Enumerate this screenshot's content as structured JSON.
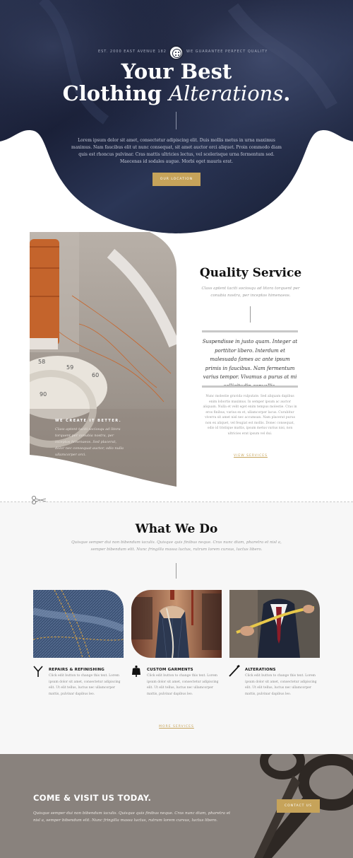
{
  "hero": {
    "est_text": "EST. 2000 EAST AVENUE 182",
    "guarantee_text": "WE GUARANTEE PERFECT QUALITY",
    "title_line1": "Your Best",
    "title_line2_plain": "Clothing ",
    "title_line2_italic": "Alterations",
    "title_line2_end": ".",
    "body": "Lorem ipsum dolor sit amet, consectetur adipiscing elit. Duis mollis metus in urna maximus maximus. Nam faucibus elit ut nunc consequat, sit amet auctor orci aliquet. Proin commodo diam quis est rhoncus pulvinar. Cras mattis ultricies lectus, vel scelerisque urna fermentum sed. Maecenas id sodales augue. Morbi eget mauris erat.",
    "button_label": "OUR LOCATION"
  },
  "quality": {
    "overlay_title": "WE CREATE IT BETTER.",
    "overlay_text": "Class aptent taciti sociosqu ad litora torquent per conubia nostra, per inceptos himenaeos. Sed placerat, dolor nec consequat auctor, odio nulla ullamcorper orci.",
    "title": "Quality Service",
    "subtitle": "Class aptent taciti sociosqu ad litora torquent per conubia nostra, per inceptos himenaeos.",
    "quote": "Suspendisse in justo quam. Integer at porttitor libero. Interdum et malesuada fames ac ante ipsum primis in faucibus. Nam fermentum varius tempor. Vivamus a purus at mi sollicitudin convallis.",
    "body": "Nunc molestie gravida vulputate. Sed aliquam dapibus enim lobortis maximus. In semper ipsum ac auctor aliquam. Nulla et velit eget enim tempus molestie. Cras in eros finibus, varius ex et, ullamcorper lacus. Curabitur viverra sit amet nisl nec accumsan. Nam placerat purus non ex aliquet, vel feugiat est mollis. Donec consequat, odio id tristique mattis, ipsum metus varius nisi, non ultricies erat ipsum vel dui.",
    "link_label": "VIEW SERVICES"
  },
  "what_we_do": {
    "title": "What We Do",
    "subtitle": "Quisque semper dui non bibendum iaculis. Quisque quis finibus neque. Cras nunc diam, pharetra et nisl a, semper bibendum elit. Nunc fringilla massa luctus, rutrum lorem cursus, luctus libero.",
    "cards": [
      {
        "title": "REPAIRS & REFINISHING",
        "text": "Click edit button to change this text. Lorem ipsum dolor sit amet, consectetur adipiscing elit. Ut elit tellus, luctus nec ullamcorper mattis, pulvinar dapibus leo.",
        "icon": "needle-thread-icon"
      },
      {
        "title": "CUSTOM GARMENTS",
        "text": "Click edit button to change this text. Lorem ipsum dolor sit amet, consectetur adipiscing elit. Ut elit tellus, luctus nec ullamcorper mattis, pulvinar dapibus leo.",
        "icon": "mannequin-icon"
      },
      {
        "title": "ALTERATIONS",
        "text": "Click edit button to change this text. Lorem ipsum dolor sit amet, consectetur adipiscing elit. Ut elit tellus, luctus nec ullamcorper mattis, pulvinar dapibus leo.",
        "icon": "needle-icon"
      }
    ],
    "link_label": "MORE SERVICES"
  },
  "cta": {
    "title": "COME & VISIT US TODAY.",
    "text": "Quisque semper dui non bibendum iaculis. Quisque quis finibus neque. Cras nunc diam, pharetra et nisl a, semper bibendum elit. Nunc fringilla massa luctus, rutrum lorem cursus, luctus libero.",
    "button_label": "CONTACT US"
  },
  "colors": {
    "accent": "#c6a35a",
    "hero_navy": "#1e2640",
    "cta_bg": "#8c8680",
    "section_gray": "#f7f7f7"
  }
}
